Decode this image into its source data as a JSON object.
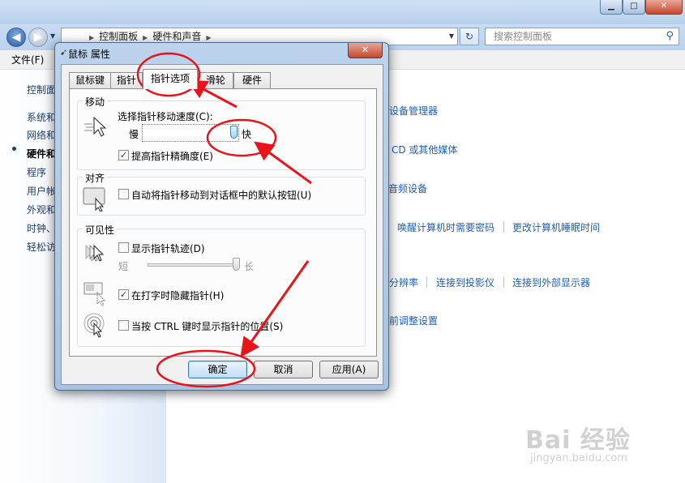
{
  "explorer": {
    "window_buttons": {
      "min": "▁",
      "max": "□",
      "close": "✕"
    },
    "address_parts": [
      "控制面板",
      "硬件和声音"
    ],
    "search_placeholder": "搜索控制面板",
    "menu_file": "文件(F)",
    "sidebar": {
      "items": [
        "控制面",
        "系统和",
        "网络和",
        "硬件和",
        "程序",
        "用户帐",
        "外观和",
        "时钟、",
        "轻松访"
      ]
    },
    "links": {
      "device_manager": "设备管理器",
      "cd_media": "CD 或其他媒体",
      "audio": "音频设备",
      "wake_password": "唤醒计算机时需要密码",
      "sleep_time": "更改计算机睡眠时间",
      "resolution": "分辨率",
      "projector": "连接到投影仪",
      "external_display": "连接到外部显示器",
      "adjust_settings": "前调整设置"
    },
    "watermark": {
      "main": "Bai 经验",
      "sub": "jingyan.baidu.com"
    }
  },
  "dialog": {
    "title": "鼠标 属性",
    "close": "✕",
    "tabs": [
      "鼠标键",
      "指针",
      "指针选项",
      "滑轮",
      "硬件"
    ],
    "active_tab": 2,
    "motion": {
      "title": "移动",
      "speed_label": "选择指针移动速度(C):",
      "slow": "慢",
      "fast": "快",
      "speed_level": 0.95,
      "enhance_precision": "提高指针精确度(E)",
      "enhance_checked": true
    },
    "snap": {
      "title": "对齐",
      "label": "自动将指针移动到对话框中的默认按钮(U)",
      "checked": false
    },
    "visibility": {
      "title": "可见性",
      "trails_label": "显示指针轨迹(D)",
      "trails_checked": false,
      "short": "短",
      "long": "长",
      "trails_level": 1.0,
      "hide_label": "在打字时隐藏指针(H)",
      "hide_checked": true,
      "ctrl_label": "当按 CTRL 键时显示指针的位置(S)",
      "ctrl_checked": false
    },
    "buttons": {
      "ok": "确定",
      "cancel": "取消",
      "apply": "应用(A)"
    }
  }
}
